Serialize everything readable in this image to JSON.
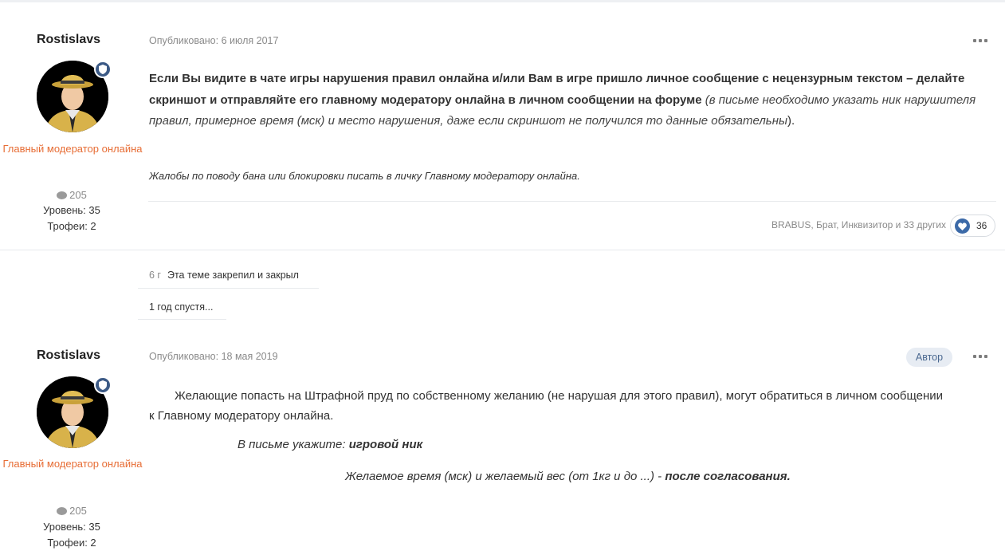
{
  "posts": [
    {
      "author": "Rostislavs",
      "group": "Главный модератор онлайна",
      "posts_count": "205",
      "level": "Уровень: 35",
      "trophies": "Трофеи: 2",
      "published": "Опубликовано: 6 июля 2017",
      "content": {
        "bold_text": "Если Вы видите в чате игры нарушения правил онлайна и/или Вам в игре пришло личное сообщение с нецензурным текстом  – делайте скриншот и отправляйте его главному модератору онлайна в личном сообщении на форуме",
        "italic_text": " (в письме необходимо указать ник нарушителя правил, примерное время (мск) и место нарушения, даже если скриншот не получился то данные обязательны",
        "closing_paren": ").",
        "complaint_note": "Жалобы по поводу бана или блокировки писать в личку Главному модератору онлайна."
      },
      "reactions": {
        "names": "BRABUS, Брат, Инквизитор и 33 других",
        "count": "36"
      }
    },
    {
      "author": "Rostislavs",
      "group": "Главный модератор онлайна",
      "posts_count": "205",
      "level": "Уровень: 35",
      "trophies": "Трофеи: 2",
      "published": "Опубликовано: 18 мая 2019",
      "author_badge": "Автор",
      "content": {
        "intro": "Желающие попасть на Штрафной пруд по собственному желанию (не нарушая для этого правил), могут обратиться в личном сообщении к Главному модератору онлайна.",
        "letter_label": "В письме укажите: ",
        "letter_value": "игровой ник",
        "time_label": "Желаемое время (мск) и желаемый вес (от 1кг и до ...) - ",
        "time_value": "после согласования."
      }
    }
  ],
  "events": [
    {
      "time": "6 г",
      "text": "Эта теме закрепил и закрыл"
    },
    {
      "text": "1 год спустя..."
    }
  ],
  "colors": {
    "group": "#e76d35",
    "meta": "#8a8a8a",
    "badge_bg": "#3c5a86",
    "react_heart": "#3c6aa8",
    "author_tag_bg": "#e7ecf3"
  }
}
